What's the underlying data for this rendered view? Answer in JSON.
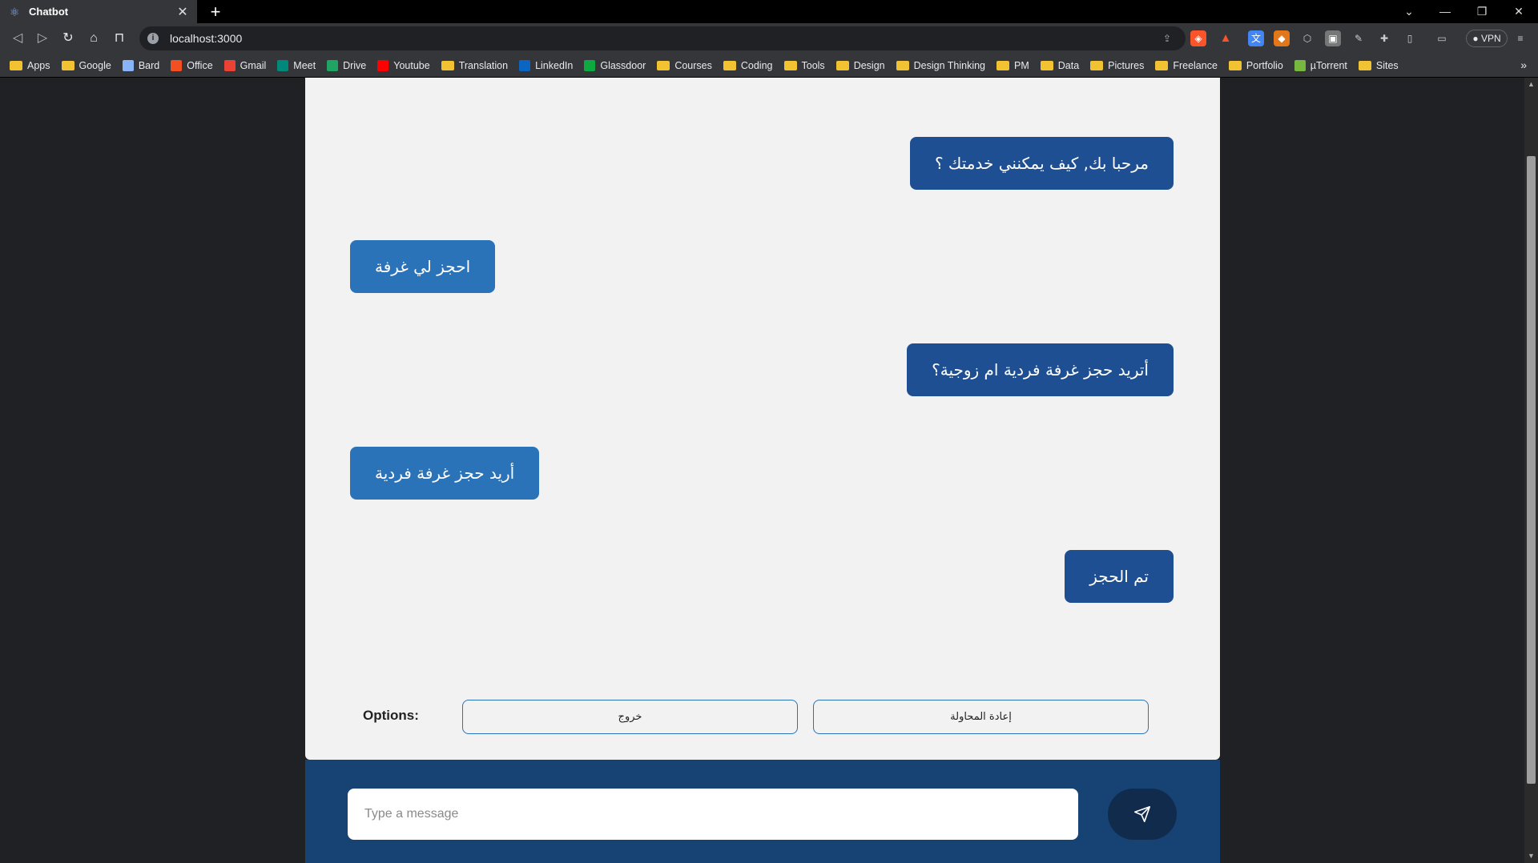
{
  "browser": {
    "tab_title": "Chatbot",
    "url": "localhost:3000",
    "vpn_label": "VPN",
    "bookmarks": [
      "Apps",
      "Google",
      "Bard",
      "Office",
      "Gmail",
      "Meet",
      "Drive",
      "Youtube",
      "Translation",
      "LinkedIn",
      "Glassdoor",
      "Courses",
      "Coding",
      "Tools",
      "Design",
      "Design Thinking",
      "PM",
      "Data",
      "Pictures",
      "Freelance",
      "Portfolio",
      "µTorrent",
      "Sites"
    ]
  },
  "chat": {
    "messages": [
      {
        "sender": "bot",
        "text": "مرحبا بك, كيف يمكنني خدمتك ؟"
      },
      {
        "sender": "user",
        "text": "احجز لي غرفة"
      },
      {
        "sender": "bot",
        "text": "أتريد حجز غرفة فردية ام زوجية؟"
      },
      {
        "sender": "user",
        "text": "أريد حجز غرفة فردية"
      },
      {
        "sender": "bot",
        "text": "تم الحجز"
      }
    ],
    "options_label": "Options:",
    "options": [
      "خروج",
      "إعادة المحاولة"
    ],
    "input_placeholder": "Type a message"
  },
  "colors": {
    "bot_bubble": "#1f4f93",
    "user_bubble": "#2a73b9",
    "composer_bg": "#174274",
    "send_button": "#102b4c"
  }
}
